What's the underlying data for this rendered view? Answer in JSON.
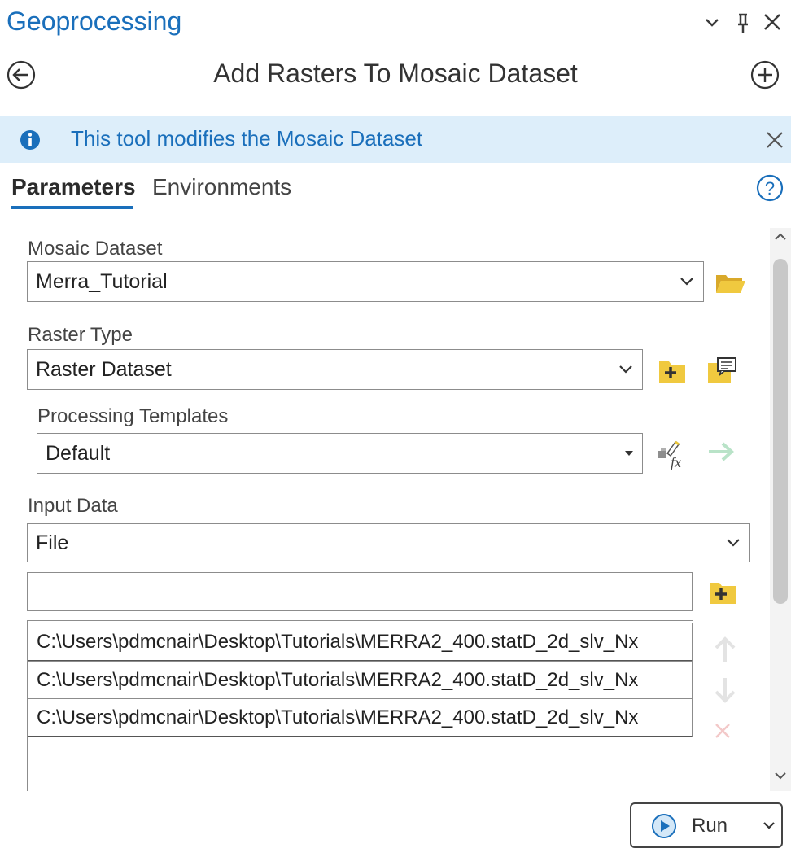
{
  "pane": {
    "title": "Geoprocessing",
    "controls": {
      "options": "⌄",
      "pin": "⚲",
      "close": "✕"
    }
  },
  "tool": {
    "title": "Add Rasters To Mosaic Dataset",
    "back_icon": "arrow-left-circle-icon",
    "add_icon": "plus-circle-icon"
  },
  "info": {
    "message": "This tool modifies the Mosaic Dataset",
    "close": "✕"
  },
  "tabs": {
    "parameters": "Parameters",
    "environments": "Environments",
    "help": "?"
  },
  "params": {
    "mosaic_dataset": {
      "label": "Mosaic Dataset",
      "value": "Merra_Tutorial"
    },
    "raster_type": {
      "label": "Raster Type",
      "value": "Raster Dataset"
    },
    "processing_templates": {
      "label": "Processing Templates",
      "value": "Default"
    },
    "input_data": {
      "label": "Input Data",
      "type_value": "File",
      "new_item_value": "",
      "items": [
        "C:\\Users\\pdmcnair\\Desktop\\Tutorials\\MERRA2_400.statD_2d_slv_Nx",
        "C:\\Users\\pdmcnair\\Desktop\\Tutorials\\MERRA2_400.statD_2d_slv_Nx",
        "C:\\Users\\pdmcnair\\Desktop\\Tutorials\\MERRA2_400.statD_2d_slv_Nx"
      ]
    }
  },
  "run": {
    "label": "Run"
  },
  "colors": {
    "accent": "#1a6fbb",
    "info_bg": "#ddeefa",
    "folder": "#e9c53a",
    "arrow_disabled": "#b9e3c8"
  }
}
